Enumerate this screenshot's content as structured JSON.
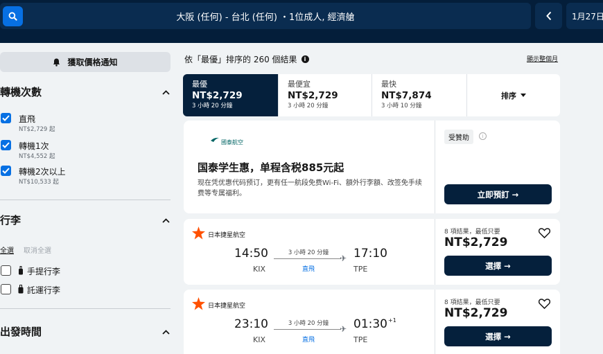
{
  "header": {
    "query": "大阪 (任何) - 台北 (任何) ・1位成人, 經濟艙",
    "date": "1月27日"
  },
  "sidebar": {
    "alert_label": "獲取價格通知",
    "stops": {
      "title": "轉機次數",
      "options": [
        {
          "label": "直飛",
          "price": "NT$2,729 起",
          "checked": true
        },
        {
          "label": "轉機1次",
          "price": "NT$4,552 起",
          "checked": true
        },
        {
          "label": "轉機2次以上",
          "price": "NT$10,533 起",
          "checked": true
        }
      ]
    },
    "baggage": {
      "title": "行李",
      "select_all": "全選",
      "clear_all": "取消全選",
      "options": [
        {
          "label": "手提行李",
          "checked": false
        },
        {
          "label": "託運行李",
          "checked": false
        }
      ]
    },
    "departure": {
      "title": "出發時間"
    }
  },
  "main": {
    "results_text": "依「最優」排序的 260 個結果",
    "month_link": "顯示整個月",
    "tabs": [
      {
        "label": "最優",
        "price": "NT$2,729",
        "duration": "3 小時 20 分鐘",
        "active": true
      },
      {
        "label": "最便宜",
        "price": "NT$2,729",
        "duration": "3 小時 20 分鐘",
        "active": false
      },
      {
        "label": "最快",
        "price": "NT$7,874",
        "duration": "3 小時 10 分鐘",
        "active": false
      }
    ],
    "sort_label": "排序",
    "ad": {
      "logo_text": "國泰航空",
      "title": "国泰学生惠，单程含税885元起",
      "text": "现在凭优惠代码预订，更有任一航段免费Wi-Fi、額外行李額、改签免手续费等专属福利。",
      "sponsored": "受贊助",
      "button": "立即預訂 →"
    },
    "flights": [
      {
        "airline": "日本捷星航空",
        "depart_time": "14:50",
        "depart_code": "KIX",
        "arrive_time": "17:10",
        "arrive_code": "TPE",
        "plus_days": "",
        "duration": "3 小時 20 分鐘",
        "stops": "直飛",
        "deals": "8 項結果，最低只要",
        "price": "NT$2,729",
        "button": "選擇 →"
      },
      {
        "airline": "日本捷星航空",
        "depart_time": "23:10",
        "depart_code": "KIX",
        "arrive_time": "01:30",
        "arrive_code": "TPE",
        "plus_days": "+1",
        "duration": "3 小時 20 分鐘",
        "stops": "直飛",
        "deals": "8 項結果，最低只要",
        "price": "NT$2,729",
        "button": "選擇 →"
      }
    ]
  },
  "colors": {
    "header_bg": "#041e3a",
    "accent": "#0770e3",
    "dark_button": "#05203c",
    "airline_star": "#ff5000"
  }
}
